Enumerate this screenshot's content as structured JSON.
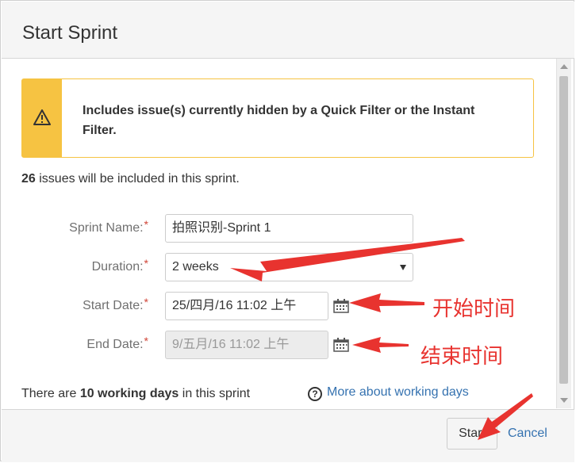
{
  "dialog": {
    "title": "Start Sprint"
  },
  "warning": {
    "icon": "warning-triangle-icon",
    "text": "Includes issue(s) currently hidden by a Quick Filter or the Instant Filter."
  },
  "issues": {
    "count": "26",
    "suffix": " issues will be included in this sprint."
  },
  "form": {
    "sprint_name": {
      "label": "Sprint Name:",
      "value": "拍照识别-Sprint 1"
    },
    "duration": {
      "label": "Duration:",
      "value": "2 weeks"
    },
    "start_date": {
      "label": "Start Date:",
      "value": "25/四月/16 11:02 上午"
    },
    "end_date": {
      "label": "End Date:",
      "value": "9/五月/16 11:02 上午"
    },
    "required_mark": "*"
  },
  "working_days": {
    "prefix": "There are ",
    "bold": "10 working days",
    "suffix": " in this sprint",
    "help_icon": "?",
    "help_link": "More about working days"
  },
  "footer": {
    "start_label": "Start",
    "cancel_label": "Cancel"
  },
  "annotations": {
    "start_time_label": "开始时间",
    "end_time_label": "结束时间",
    "arrow_color": "#e8332f"
  },
  "colors": {
    "warning": "#f6c342",
    "link": "#3572b0",
    "required": "#d04437"
  }
}
